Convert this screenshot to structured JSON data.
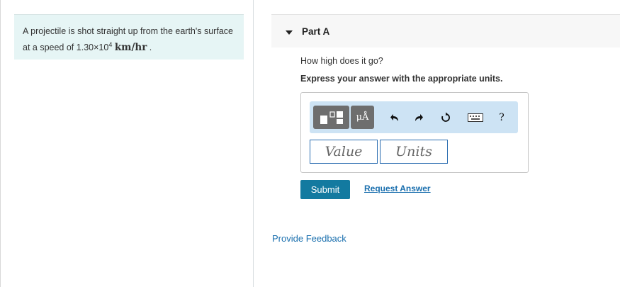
{
  "problem": {
    "text_before": "A projectile is shot straight up from the earth's surface at a speed of ",
    "coefficient": "1.30×10",
    "exponent": "4",
    "units": "km/hr",
    "text_after": " ."
  },
  "part": {
    "title": "Part A"
  },
  "question": "How high does it go?",
  "instruction": "Express your answer with the appropriate units.",
  "toolbar": {
    "units_label": "μÅ",
    "help_label": "?",
    "buttons": [
      "templates-icon",
      "units-icon",
      "undo-icon",
      "redo-icon",
      "reset-icon",
      "keyboard-icon",
      "help-icon"
    ]
  },
  "answer": {
    "value_placeholder": "Value",
    "units_placeholder": "Units"
  },
  "actions": {
    "submit_label": "Submit",
    "request_label": "Request Answer"
  },
  "footer": {
    "feedback_label": "Provide Feedback"
  },
  "colors": {
    "accent": "#137aa0",
    "link": "#1a6fae",
    "problem_bg": "#e6f5f5",
    "toolbar_bg": "#cde3f4"
  }
}
